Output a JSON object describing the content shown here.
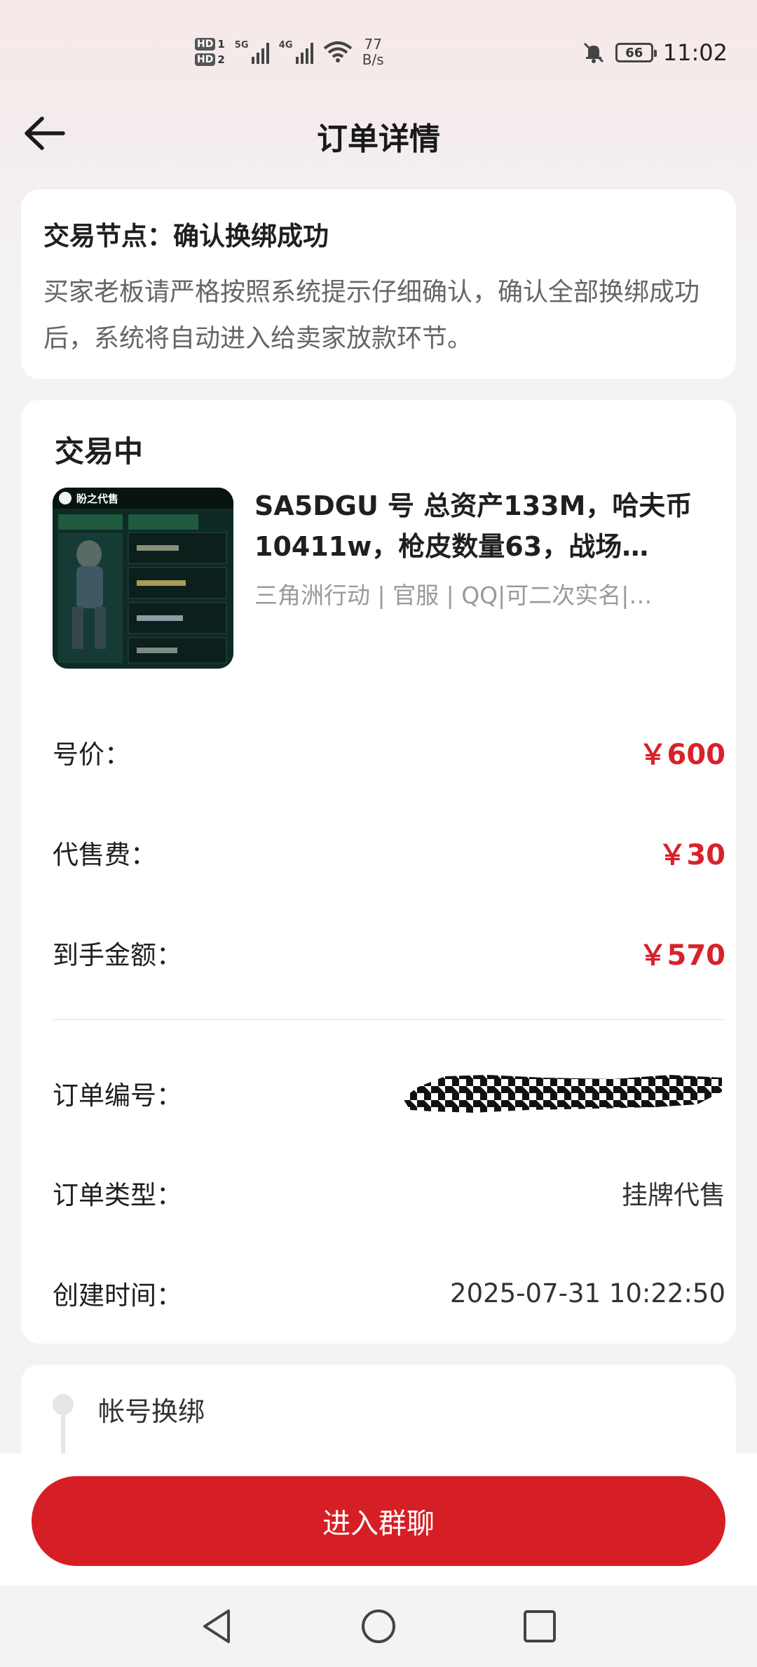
{
  "status_bar": {
    "hd1": "HD",
    "hd1_sub": "1",
    "hd2": "HD",
    "hd2_sub": "2",
    "net1": "5G",
    "net2": "4G",
    "speed_value": "77",
    "speed_unit": "B/s",
    "battery": "66",
    "time": "11:02"
  },
  "header": {
    "title": "订单详情"
  },
  "trade_node": {
    "title": "交易节点：确认换绑成功",
    "description": "买家老板请严格按照系统提示仔细确认，确认全部换绑成功后，系统将自动进入给卖家放款环节。"
  },
  "order": {
    "status": "交易中",
    "goods_title": "SA5DGU 号 总资产133M，哈夫币10411w，枪皮数量63，战场…",
    "goods_tags": "三角洲行动 | 官服 | QQ|可二次实名|…",
    "thumb_caption": "盼之代售",
    "price_label": "号价：",
    "price_value": "￥600",
    "fee_label": "代售费：",
    "fee_value": "￥30",
    "net_label": "到手金额：",
    "net_value": "￥570",
    "order_no_label": "订单编号：",
    "order_type_label": "订单类型：",
    "order_type_value": "挂牌代售",
    "created_label": "创建时间：",
    "created_value": "2025-07-31 10:22:50"
  },
  "binding": {
    "step_label": "帐号换绑"
  },
  "actions": {
    "group_chat": "进入群聊"
  },
  "colors": {
    "accent_red": "#d61f25",
    "price_red": "#d8222a"
  }
}
